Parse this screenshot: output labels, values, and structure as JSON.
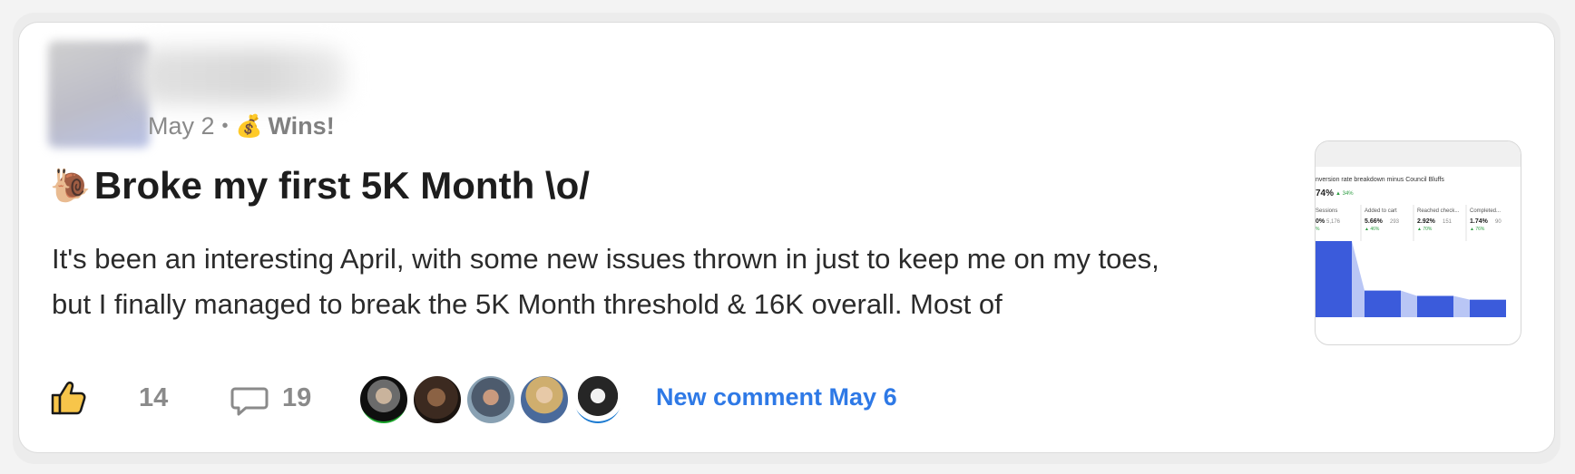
{
  "post": {
    "date": "May 2",
    "separator": "•",
    "category_icon": "money-bag-icon",
    "category_emoji": "💰",
    "category": "Wins!",
    "title_emoji": "🐌",
    "title": "Broke my first 5K Month \\o/",
    "body": "It's been an interesting April, with some new issues thrown in just to keep me on my toes, but I finally managed to break the 5K Month threshold & 16K overall. Most of"
  },
  "thumbnail": {
    "heading": "nversion rate breakdown minus Council Bluffs",
    "summary_value": "74%",
    "summary_change": "▲ 34%",
    "columns": [
      {
        "label": "Sessions",
        "value": "0%",
        "count": "5,176",
        "change": "%"
      },
      {
        "label": "Added to cart",
        "value": "5.66%",
        "count": "293",
        "change": "▲ 46%"
      },
      {
        "label": "Reached check...",
        "value": "2.92%",
        "count": "151",
        "change": "▲ 70%"
      },
      {
        "label": "Completed...",
        "value": "1.74%",
        "count": "90",
        "change": "▲ 76%"
      }
    ],
    "bar_fractions": [
      1.0,
      0.35,
      0.28,
      0.23
    ],
    "bar_color": "#3b5bdb"
  },
  "actions": {
    "like_icon": "thumbs-up-icon",
    "likes": "14",
    "comment_icon": "comment-icon",
    "comments": "19",
    "commenter_avatars": [
      "avatar-1",
      "avatar-2",
      "avatar-3",
      "avatar-4",
      "avatar-5"
    ],
    "new_comment": "New comment May 6"
  },
  "colors": {
    "accent": "#2e79e6",
    "meta_text": "#8a8a8a",
    "title_text": "#1d1d1d"
  }
}
